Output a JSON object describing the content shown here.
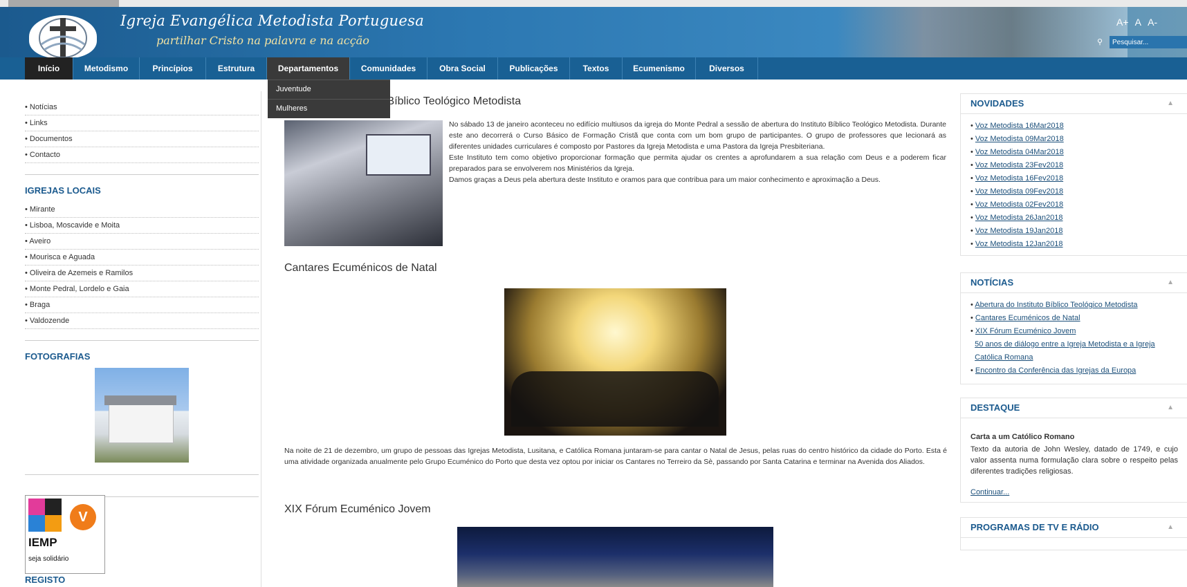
{
  "site": {
    "title": "Igreja Evangélica Metodista Portuguesa",
    "subtitle": "partilhar Cristo na palavra e na acção",
    "font_controls": [
      "A+",
      "A",
      "A-"
    ],
    "search_placeholder": "Pesquisar..."
  },
  "nav": {
    "items": [
      "Início",
      "Metodismo",
      "Princípios",
      "Estrutura",
      "Departamentos",
      "Comunidades",
      "Obra Social",
      "Publicações",
      "Textos",
      "Ecumenismo",
      "Diversos"
    ],
    "active": "Início",
    "dropdown": [
      "Juventude",
      "Mulheres"
    ]
  },
  "left": {
    "links": [
      "Notícias",
      "Links",
      "Documentos",
      "Contacto"
    ],
    "igrejas_title": "IGREJAS LOCAIS",
    "igrejas": [
      "Mirante",
      "Lisboa, Moscavide e Moita",
      "Aveiro",
      "Mourisca e Aguada",
      "Oliveira de Azemeis e Ramilos",
      "Monte Pedral, Lordelo e Gaia",
      "Braga",
      "Valdozende"
    ],
    "fotografias_title": "FOTOGRAFIAS",
    "badge_text": "IEMP",
    "badge_sub": "seja solidário",
    "badge_letter": "V",
    "registo_title": "REGISTO"
  },
  "articles": [
    {
      "title": "Abertura do Instituto Bíblico Teológico Metodista",
      "text": "No sábado 13 de janeiro aconteceu no edifício multiusos da igreja do Monte Pedral a sessão de abertura do Instituto Bíblico Teológico Metodista. Durante este ano decorrerá o Curso Básico de Formação Cristã que conta com um bom grupo de participantes. O grupo de professores que lecionará as diferentes unidades curriculares é composto por Pastores da Igreja Metodista e uma Pastora da Igreja Presbiteriana.",
      "text2": "Este Instituto tem como objetivo proporcionar formação que permita ajudar os crentes a aprofundarem a sua relação com Deus e a poderem ficar preparados para se envolverem nos Ministérios da Igreja.",
      "text3": "Damos graças a Deus pela abertura deste Instituto e oramos para que contribua para um maior conhecimento e aproximação a Deus."
    },
    {
      "title": "Cantares Ecuménicos de Natal",
      "text": "Na noite de 21 de dezembro, um grupo de pessoas das Igrejas Metodista, Lusitana, e Católica Romana juntaram-se para cantar o Natal de Jesus, pelas ruas do centro histórico da cidade do Porto. Esta é uma atividade organizada anualmente pelo Grupo Ecuménico do Porto que desta vez optou por iniciar os Cantares no Terreiro da Sè, passando por Santa Catarina e terminar na Avenida dos Aliados."
    },
    {
      "title": "XIX Fórum Ecuménico Jovem"
    }
  ],
  "right": {
    "novidades_title": "NOVIDADES",
    "novidades": [
      "Voz Metodista 16Mar2018",
      "Voz Metodista 09Mar2018",
      "Voz Metodista 04Mar2018",
      "Voz Metodista 23Fev2018",
      "Voz Metodista 16Fev2018",
      "Voz Metodista 09Fev2018",
      "Voz Metodista 02Fev2018",
      "Voz Metodista 26Jan2018",
      "Voz Metodista 19Jan2018",
      "Voz Metodista 12Jan2018"
    ],
    "noticias_title": "NOTÍCIAS",
    "noticias": [
      "Abertura do Instituto Bíblico Teológico Metodista",
      "Cantares Ecuménicos de Natal",
      "XIX Fórum Ecuménico Jovem",
      "50 anos de diálogo entre a Igreja Metodista e a Igreja",
      "Católica Romana",
      "Encontro da Conferência das Igrejas da Europa"
    ],
    "destaque_title": "DESTAQUE",
    "destaque_heading": "Carta a um Católico Romano",
    "destaque_text": "Texto da autoria de John Wesley, datado de 1749, e cujo valor assenta numa formulação clara sobre o respeito pelas diferentes tradições religiosas.",
    "destaque_link": "Continuar...",
    "programas_title": "PROGRAMAS DE TV E RÁDIO"
  },
  "colors": {
    "header": "#1b5a8e",
    "nav": "#196094",
    "accent": "#1b5a8e"
  }
}
